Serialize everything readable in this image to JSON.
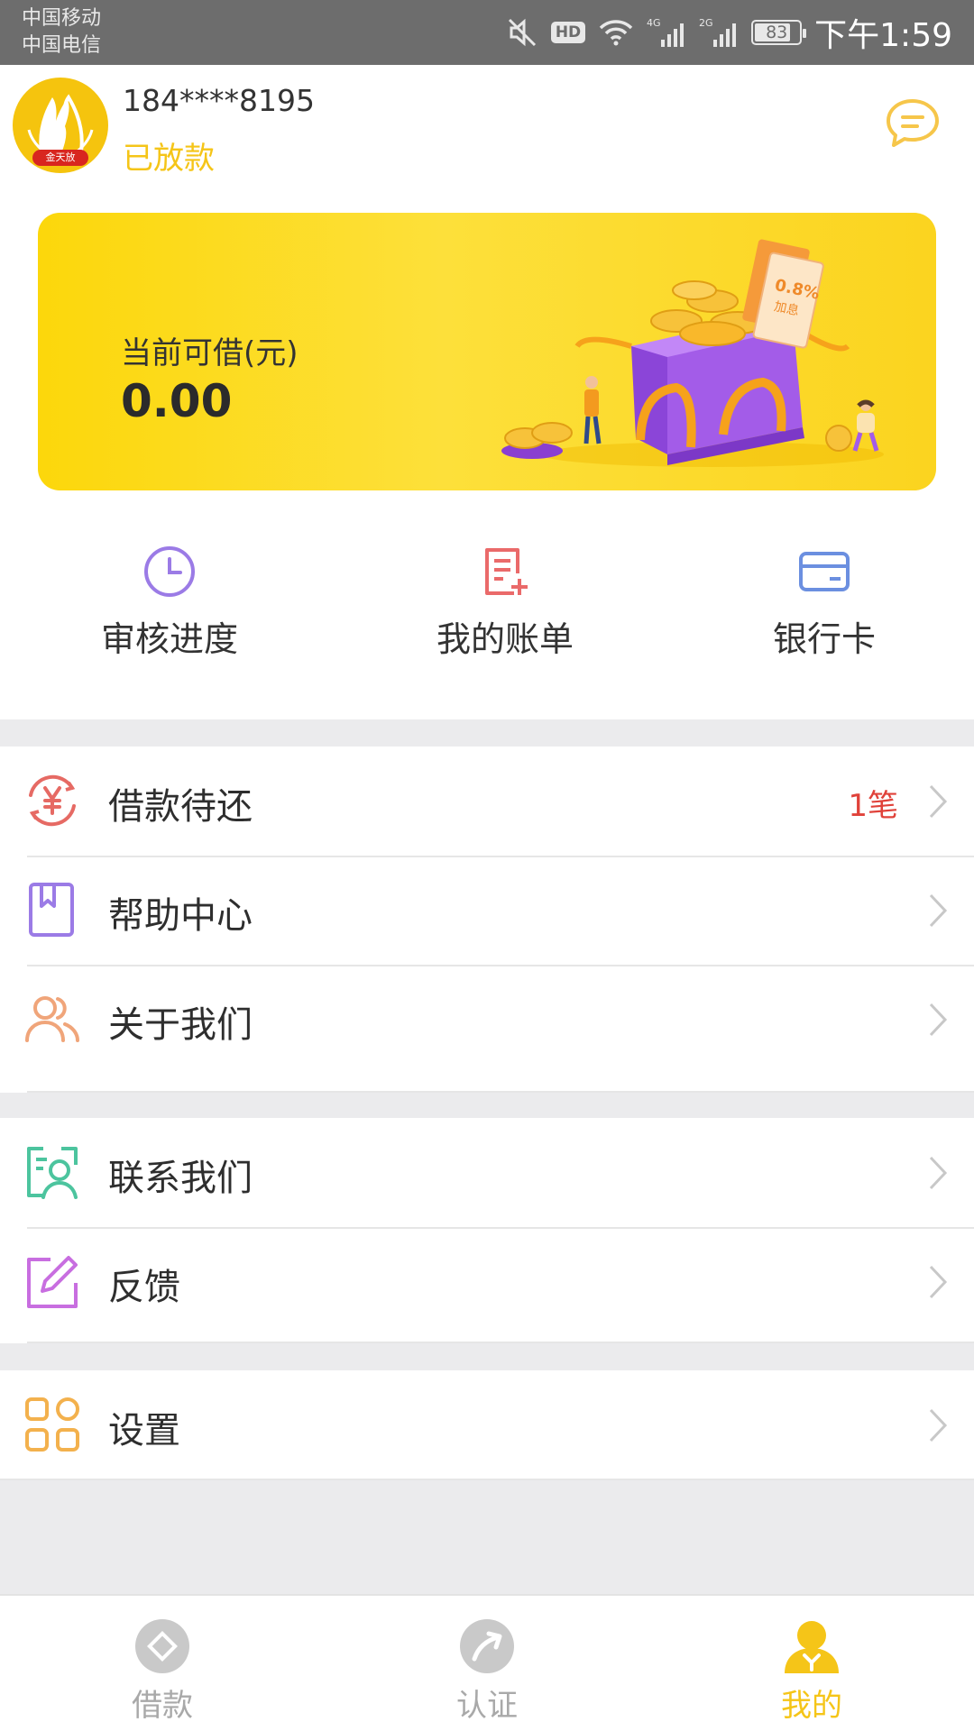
{
  "status_bar": {
    "carrier_1": "中国移动",
    "carrier_2": "中国电信",
    "hd": "HD",
    "signal_1": "4G",
    "signal_2": "2G",
    "battery": "83",
    "battery_level": 0.83,
    "time": "下午1:59",
    "icons": [
      "mute-icon",
      "wifi-icon",
      "signal-icon",
      "battery-icon"
    ]
  },
  "header": {
    "avatar_tag": "金天放",
    "phone": "184****8195",
    "status": "已放款",
    "message_icon": "chat-bubble-icon"
  },
  "banner": {
    "label": "当前可借(元)",
    "amount": "0.00",
    "art_tag": "0.8%",
    "art_subtag": "加息"
  },
  "quick_actions": [
    {
      "label": "审核进度",
      "icon": "clock-icon",
      "color": "#9b7be6"
    },
    {
      "label": "我的账单",
      "icon": "bill-icon",
      "color": "#ea6a6a"
    },
    {
      "label": "银行卡",
      "icon": "card-icon",
      "color": "#6b8fe0"
    }
  ],
  "menu": {
    "loan_due": {
      "label": "借款待还",
      "badge": "1笔",
      "icon": "yen-cycle-icon",
      "color": "#e66a64"
    },
    "help": {
      "label": "帮助中心",
      "icon": "book-icon",
      "color": "#9b7be6"
    },
    "about": {
      "label": "关于我们",
      "icon": "people-icon",
      "color": "#f0a57a"
    },
    "contact": {
      "label": "联系我们",
      "icon": "contact-card-icon",
      "color": "#4cc49e"
    },
    "feedback": {
      "label": "反馈",
      "icon": "edit-icon",
      "color": "#c86ee0"
    },
    "settings": {
      "label": "设置",
      "icon": "grid-icon",
      "color": "#f3b14d"
    }
  },
  "tabbar": {
    "tabs": [
      {
        "label": "借款",
        "icon": "diamond-icon",
        "active": false
      },
      {
        "label": "认证",
        "icon": "arrow-circle-icon",
        "active": false
      },
      {
        "label": "我的",
        "icon": "user-icon",
        "active": true
      }
    ],
    "accent": "#f5c518"
  }
}
